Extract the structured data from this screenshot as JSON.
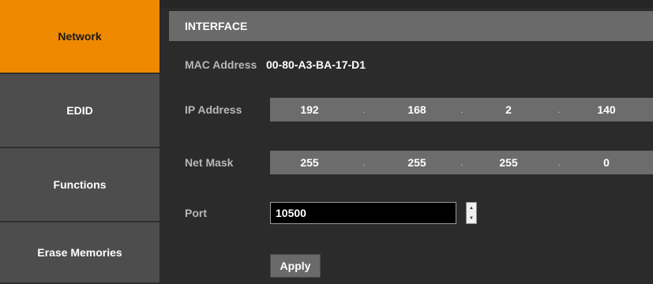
{
  "sidebar": {
    "items": [
      {
        "label": "Network"
      },
      {
        "label": "EDID"
      },
      {
        "label": "Functions"
      },
      {
        "label": "Erase Memories"
      }
    ]
  },
  "header": {
    "title": "INTERFACE"
  },
  "mac": {
    "label": "MAC Address",
    "value": "00-80-A3-BA-17-D1"
  },
  "ip": {
    "label": "IP Address",
    "octets": [
      "192",
      "168",
      "2",
      "140"
    ],
    "separator": "."
  },
  "netmask": {
    "label": "Net Mask",
    "octets": [
      "255",
      "255",
      "255",
      "0"
    ],
    "separator": "."
  },
  "port": {
    "label": "Port",
    "value": "10500"
  },
  "apply": {
    "label": "Apply"
  },
  "colors": {
    "accent": "#ef8a00",
    "header": "#6a6a6a",
    "field": "#6c6c6c"
  },
  "icons": {
    "stepper_up": "caret-up-icon",
    "stepper_down": "caret-down-icon"
  }
}
